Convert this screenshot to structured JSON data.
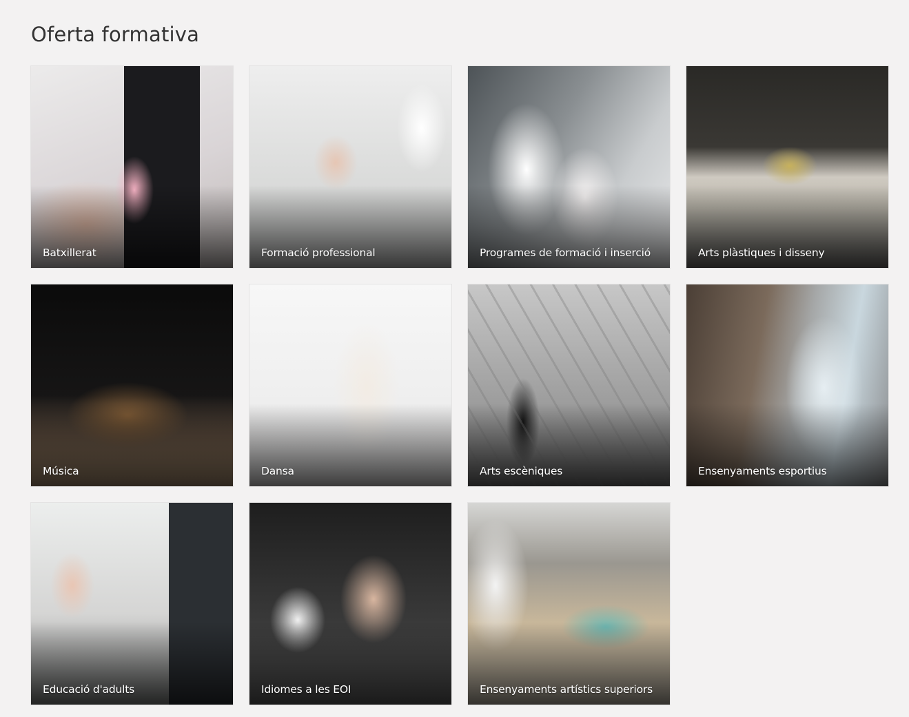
{
  "section": {
    "title": "Oferta formativa"
  },
  "cards": [
    {
      "label": "Batxillerat",
      "image": "phone-lab-photo"
    },
    {
      "label": "Formació professional",
      "image": "laboratory-photo"
    },
    {
      "label": "Programes de formació i inserció",
      "image": "kitchen-chefs-photo"
    },
    {
      "label": "Arts plàstiques i disseny",
      "image": "jewelry-workshop-photo"
    },
    {
      "label": "Música",
      "image": "orchestra-photo"
    },
    {
      "label": "Dansa",
      "image": "ballet-dancers-photo"
    },
    {
      "label": "Arts escèniques",
      "image": "circus-acrobats-photo"
    },
    {
      "label": "Ensenyaments esportius",
      "image": "ice-climber-photo"
    },
    {
      "label": "Educació d'adults",
      "image": "computer-classroom-photo"
    },
    {
      "label": "Idiomes a les EOI",
      "image": "exam-students-photo"
    },
    {
      "label": "Ensenyaments artístics superiors",
      "image": "restoration-workshop-photo"
    }
  ]
}
